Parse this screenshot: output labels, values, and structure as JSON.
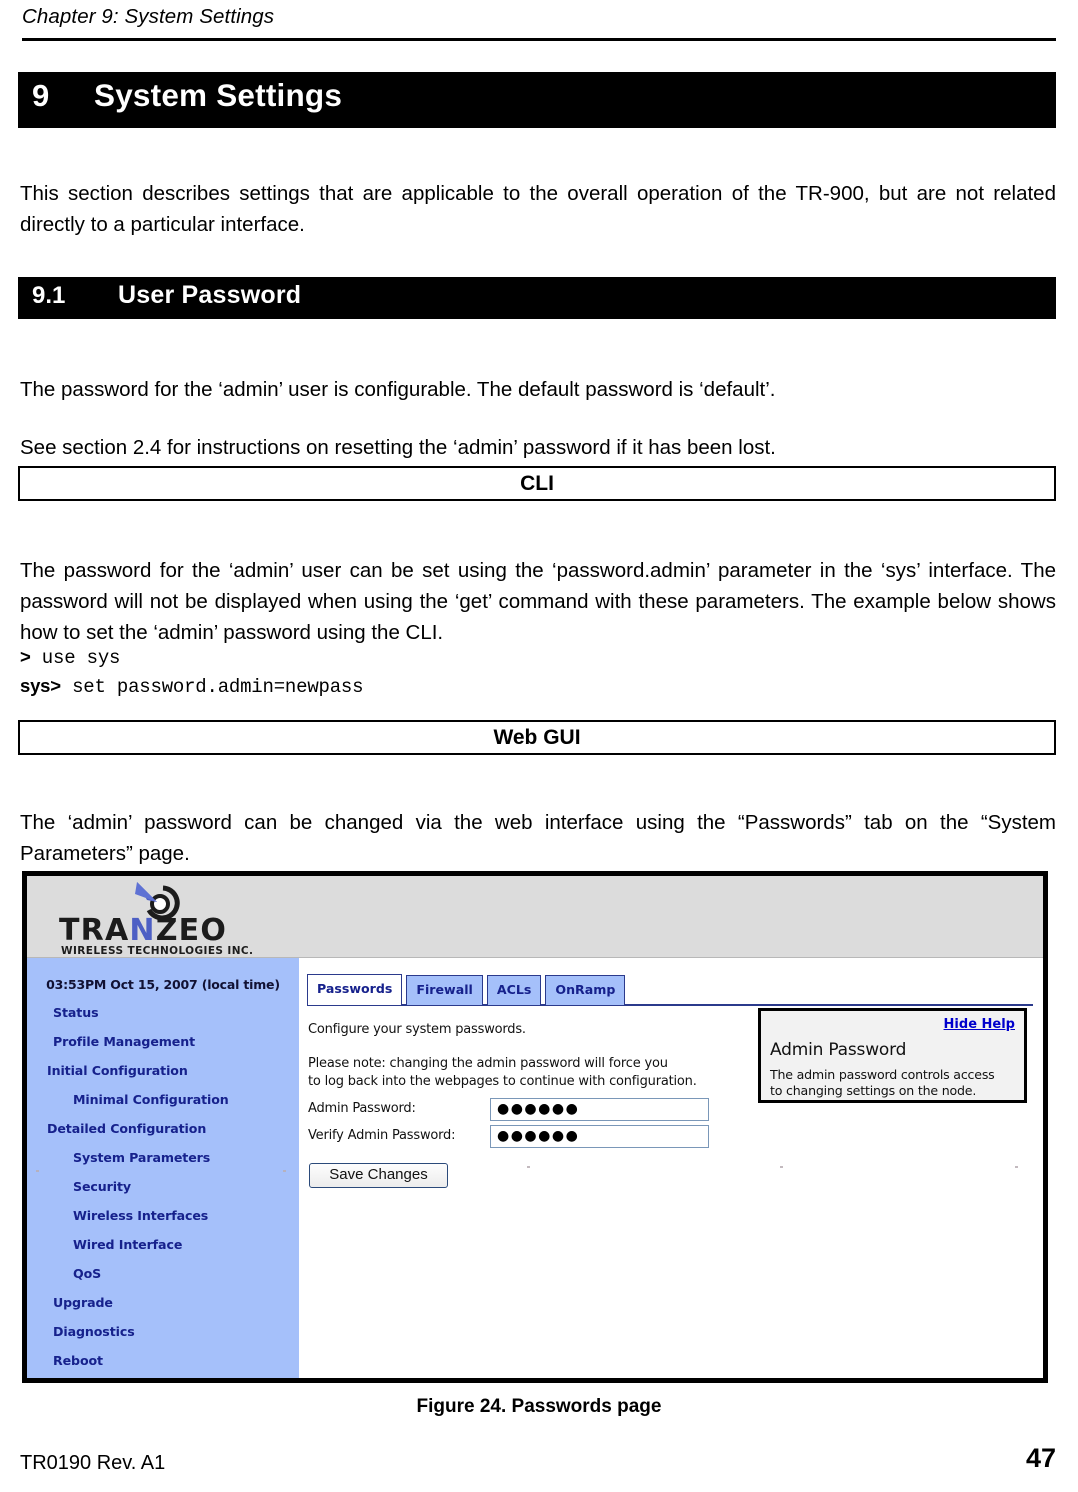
{
  "document": {
    "running_header": "Chapter 9: System Settings",
    "footer_left": "TR0190 Rev. A1",
    "page_number": "47",
    "figure_caption": "Figure 24. Passwords page"
  },
  "chapter": {
    "number": "9",
    "title": "System Settings",
    "intro": "This section describes settings that are applicable to the overall operation of the TR-900, but are not related directly to a particular interface."
  },
  "section": {
    "number": "9.1",
    "title": "User Password",
    "para_1": "The password for the ‘admin’ user is configurable. The default password is ‘default’.",
    "para_2": "See section 2.4 for instructions on resetting the ‘admin’ password if it has been lost."
  },
  "cli": {
    "box_label": "CLI",
    "para": "The password for the ‘admin’ user can be set using the ‘password.admin’ parameter in the ‘sys’ interface. The password will not be displayed when using the ‘get’ command with these parameters. The example below shows how to set the ‘admin’ password using the CLI.",
    "lines": [
      {
        "prompt": ">",
        "command": " use sys"
      },
      {
        "prompt": "sys>",
        "command": " set password.admin=newpass"
      }
    ]
  },
  "webgui": {
    "box_label": "Web GUI",
    "para": "The ‘admin’ password can be changed via the web interface using the “Passwords” tab on the “System Parameters” page."
  },
  "screenshot": {
    "logo": {
      "wordmark_pre": "TRA",
      "wordmark_n": "N",
      "wordmark_post": "ZEO",
      "tagline": "WIRELESS TECHNOLOGIES INC."
    },
    "sidebar": {
      "clock": "03:53PM Oct 15, 2007 (local time)",
      "items": [
        {
          "label": "Status",
          "level": 1
        },
        {
          "label": "Profile Management",
          "level": 1
        },
        {
          "label": "Initial Configuration",
          "level": 0
        },
        {
          "label": "Minimal Configuration",
          "level": 2
        },
        {
          "label": "Detailed Configuration",
          "level": 0
        },
        {
          "label": "System Parameters",
          "level": 2
        },
        {
          "label": "Security",
          "level": 2
        },
        {
          "label": "Wireless Interfaces",
          "level": 2
        },
        {
          "label": "Wired Interface",
          "level": 2
        },
        {
          "label": "QoS",
          "level": 2
        },
        {
          "label": "Upgrade",
          "level": 1
        },
        {
          "label": "Diagnostics",
          "level": 1
        },
        {
          "label": "Reboot",
          "level": 1
        }
      ]
    },
    "tabs": [
      {
        "label": "Passwords",
        "active": true
      },
      {
        "label": "Firewall",
        "active": false
      },
      {
        "label": "ACLs",
        "active": false
      },
      {
        "label": "OnRamp",
        "active": false
      }
    ],
    "content": {
      "intro": "Configure your system passwords.",
      "note_line_1": "Please note: changing the admin password will force you",
      "note_line_2": "to log back into the webpages to continue with configuration.",
      "admin_password_label": "Admin Password:",
      "admin_password_value": "●●●●●●",
      "verify_password_label": "Verify Admin Password:",
      "verify_password_value": "●●●●●●",
      "save_button": "Save Changes"
    },
    "help": {
      "hide_link": "Hide Help",
      "title": "Admin Password",
      "body_line_1": "The admin password controls access",
      "body_line_2": "to changing settings on the node."
    },
    "colors": {
      "sidebar_blue": "#a5c0fa",
      "nav_text_blue": "#16218c",
      "banner_gray": "#dcdcdc",
      "link_blue": "#0000cc",
      "logo_accent": "#4d5fc4"
    }
  }
}
